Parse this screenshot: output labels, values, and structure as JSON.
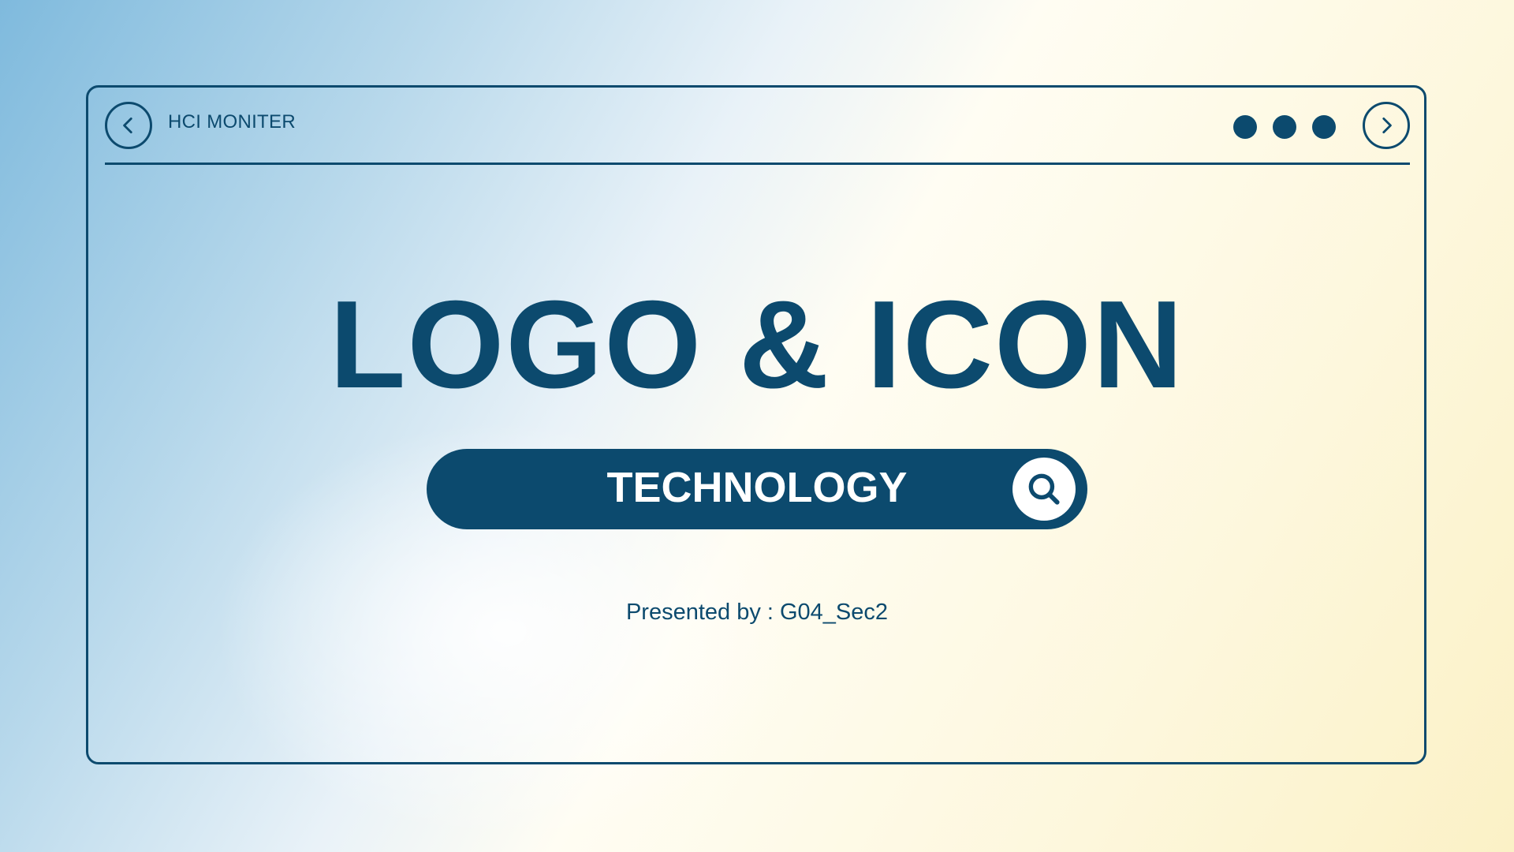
{
  "window": {
    "title": "HCI MONITER",
    "back_icon": "chevron-left-icon",
    "forward_icon": "chevron-right-icon",
    "menu_icon": "three-dots-icon"
  },
  "slide": {
    "headline": "LOGO & ICON",
    "search_text": "TECHNOLOGY",
    "search_icon": "search-icon",
    "presenter": "Presented by : G04_Sec2"
  },
  "colors": {
    "primary": "#0c4a6e",
    "gradient_left": "#7fbadd",
    "gradient_right": "#fbf1c6"
  }
}
